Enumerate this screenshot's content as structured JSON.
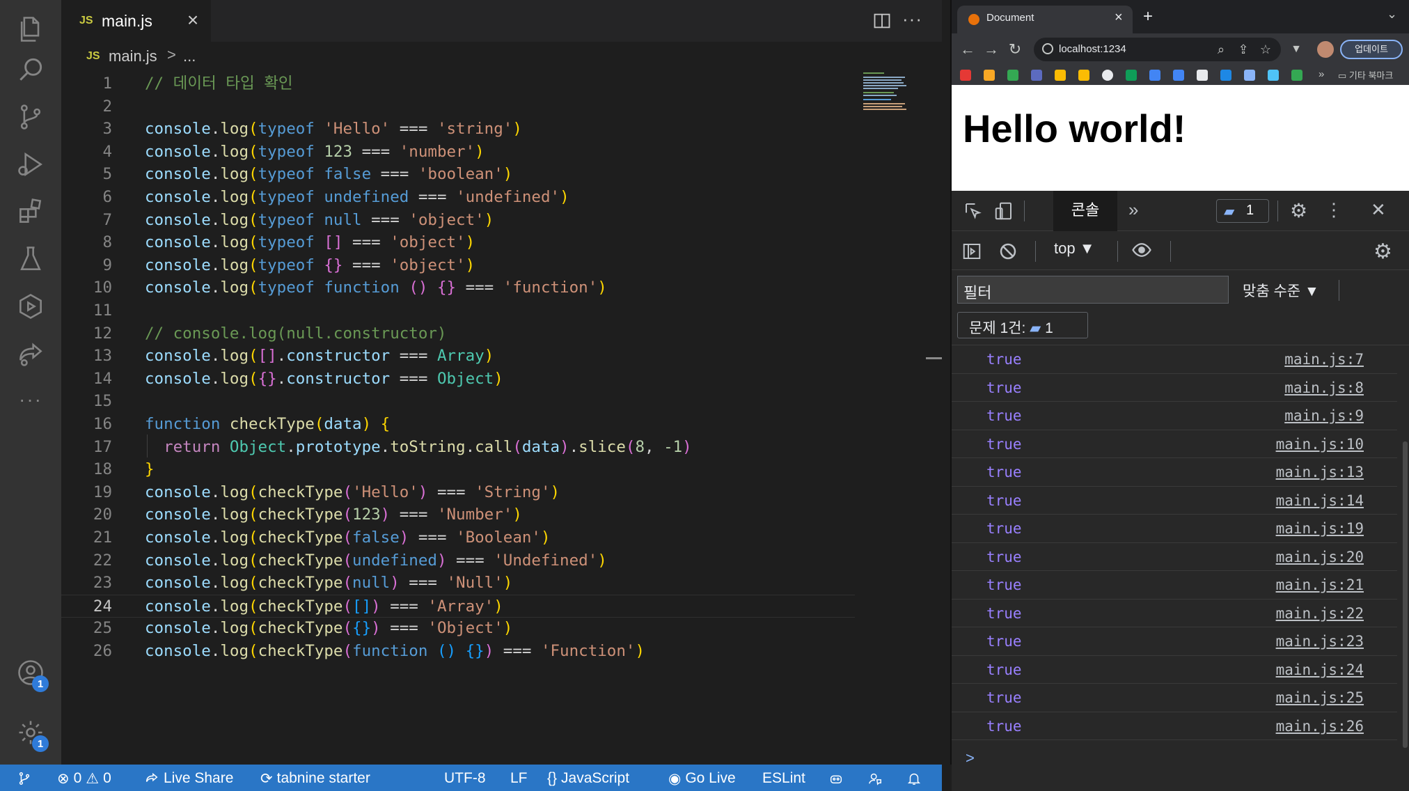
{
  "editor": {
    "tab_label": "main.js",
    "tab_badge": "JS",
    "breadcrumb_file": "main.js",
    "breadcrumb_sep": ">",
    "breadcrumb_rest": "...",
    "current_line": 24,
    "lines": [
      {
        "n": "1",
        "t": [
          [
            "cmt",
            "// 데이터 타입 확인"
          ]
        ]
      },
      {
        "n": "2",
        "t": []
      },
      {
        "n": "3",
        "t": [
          [
            "obj",
            "console"
          ],
          [
            "op",
            "."
          ],
          [
            "fn",
            "log"
          ],
          [
            "b1",
            "("
          ],
          [
            "kw",
            "typeof "
          ],
          [
            "str",
            "'Hello'"
          ],
          [
            "op",
            " === "
          ],
          [
            "str",
            "'string'"
          ],
          [
            "b1",
            ")"
          ]
        ]
      },
      {
        "n": "4",
        "t": [
          [
            "obj",
            "console"
          ],
          [
            "op",
            "."
          ],
          [
            "fn",
            "log"
          ],
          [
            "b1",
            "("
          ],
          [
            "kw",
            "typeof "
          ],
          [
            "num",
            "123"
          ],
          [
            "op",
            " === "
          ],
          [
            "str",
            "'number'"
          ],
          [
            "b1",
            ")"
          ]
        ]
      },
      {
        "n": "5",
        "t": [
          [
            "obj",
            "console"
          ],
          [
            "op",
            "."
          ],
          [
            "fn",
            "log"
          ],
          [
            "b1",
            "("
          ],
          [
            "kw",
            "typeof false"
          ],
          [
            "op",
            " === "
          ],
          [
            "str",
            "'boolean'"
          ],
          [
            "b1",
            ")"
          ]
        ]
      },
      {
        "n": "6",
        "t": [
          [
            "obj",
            "console"
          ],
          [
            "op",
            "."
          ],
          [
            "fn",
            "log"
          ],
          [
            "b1",
            "("
          ],
          [
            "kw",
            "typeof undefined"
          ],
          [
            "op",
            " === "
          ],
          [
            "str",
            "'undefined'"
          ],
          [
            "b1",
            ")"
          ]
        ]
      },
      {
        "n": "7",
        "t": [
          [
            "obj",
            "console"
          ],
          [
            "op",
            "."
          ],
          [
            "fn",
            "log"
          ],
          [
            "b1",
            "("
          ],
          [
            "kw",
            "typeof null"
          ],
          [
            "op",
            " === "
          ],
          [
            "str",
            "'object'"
          ],
          [
            "b1",
            ")"
          ]
        ]
      },
      {
        "n": "8",
        "t": [
          [
            "obj",
            "console"
          ],
          [
            "op",
            "."
          ],
          [
            "fn",
            "log"
          ],
          [
            "b1",
            "("
          ],
          [
            "kw",
            "typeof "
          ],
          [
            "b2",
            "[]"
          ],
          [
            "op",
            " === "
          ],
          [
            "str",
            "'object'"
          ],
          [
            "b1",
            ")"
          ]
        ]
      },
      {
        "n": "9",
        "t": [
          [
            "obj",
            "console"
          ],
          [
            "op",
            "."
          ],
          [
            "fn",
            "log"
          ],
          [
            "b1",
            "("
          ],
          [
            "kw",
            "typeof "
          ],
          [
            "b2",
            "{}"
          ],
          [
            "op",
            " === "
          ],
          [
            "str",
            "'object'"
          ],
          [
            "b1",
            ")"
          ]
        ]
      },
      {
        "n": "10",
        "t": [
          [
            "obj",
            "console"
          ],
          [
            "op",
            "."
          ],
          [
            "fn",
            "log"
          ],
          [
            "b1",
            "("
          ],
          [
            "kw",
            "typeof function "
          ],
          [
            "b2",
            "()"
          ],
          [
            "op",
            " "
          ],
          [
            "b2",
            "{}"
          ],
          [
            "op",
            " === "
          ],
          [
            "str",
            "'function'"
          ],
          [
            "b1",
            ")"
          ]
        ]
      },
      {
        "n": "11",
        "t": []
      },
      {
        "n": "12",
        "t": [
          [
            "cmt",
            "// console.log(null.constructor)"
          ]
        ]
      },
      {
        "n": "13",
        "t": [
          [
            "obj",
            "console"
          ],
          [
            "op",
            "."
          ],
          [
            "fn",
            "log"
          ],
          [
            "b1",
            "("
          ],
          [
            "b2",
            "[]"
          ],
          [
            "op",
            "."
          ],
          [
            "obj",
            "constructor"
          ],
          [
            "op",
            " === "
          ],
          [
            "cls",
            "Array"
          ],
          [
            "b1",
            ")"
          ]
        ]
      },
      {
        "n": "14",
        "t": [
          [
            "obj",
            "console"
          ],
          [
            "op",
            "."
          ],
          [
            "fn",
            "log"
          ],
          [
            "b1",
            "("
          ],
          [
            "b2",
            "{}"
          ],
          [
            "op",
            "."
          ],
          [
            "obj",
            "constructor"
          ],
          [
            "op",
            " === "
          ],
          [
            "cls",
            "Object"
          ],
          [
            "b1",
            ")"
          ]
        ]
      },
      {
        "n": "15",
        "t": []
      },
      {
        "n": "16",
        "t": [
          [
            "kw",
            "function "
          ],
          [
            "fn",
            "checkType"
          ],
          [
            "b1",
            "("
          ],
          [
            "par",
            "data"
          ],
          [
            "b1",
            ")"
          ],
          [
            "op",
            " "
          ],
          [
            "b1",
            "{"
          ]
        ]
      },
      {
        "n": "17",
        "t": [
          [
            "op",
            "  "
          ],
          [
            "ctl",
            "return "
          ],
          [
            "cls",
            "Object"
          ],
          [
            "op",
            "."
          ],
          [
            "obj",
            "prototype"
          ],
          [
            "op",
            "."
          ],
          [
            "fn",
            "toString"
          ],
          [
            "op",
            "."
          ],
          [
            "fn",
            "call"
          ],
          [
            "b2",
            "("
          ],
          [
            "par",
            "data"
          ],
          [
            "b2",
            ")"
          ],
          [
            "op",
            "."
          ],
          [
            "fn",
            "slice"
          ],
          [
            "b2",
            "("
          ],
          [
            "num",
            "8"
          ],
          [
            "op",
            ", "
          ],
          [
            "num",
            "-1"
          ],
          [
            "b2",
            ")"
          ]
        ]
      },
      {
        "n": "18",
        "t": [
          [
            "b1",
            "}"
          ]
        ]
      },
      {
        "n": "19",
        "t": [
          [
            "obj",
            "console"
          ],
          [
            "op",
            "."
          ],
          [
            "fn",
            "log"
          ],
          [
            "b1",
            "("
          ],
          [
            "fn",
            "checkType"
          ],
          [
            "b2",
            "("
          ],
          [
            "str",
            "'Hello'"
          ],
          [
            "b2",
            ")"
          ],
          [
            "op",
            " === "
          ],
          [
            "str",
            "'String'"
          ],
          [
            "b1",
            ")"
          ]
        ]
      },
      {
        "n": "20",
        "t": [
          [
            "obj",
            "console"
          ],
          [
            "op",
            "."
          ],
          [
            "fn",
            "log"
          ],
          [
            "b1",
            "("
          ],
          [
            "fn",
            "checkType"
          ],
          [
            "b2",
            "("
          ],
          [
            "num",
            "123"
          ],
          [
            "b2",
            ")"
          ],
          [
            "op",
            " === "
          ],
          [
            "str",
            "'Number'"
          ],
          [
            "b1",
            ")"
          ]
        ]
      },
      {
        "n": "21",
        "t": [
          [
            "obj",
            "console"
          ],
          [
            "op",
            "."
          ],
          [
            "fn",
            "log"
          ],
          [
            "b1",
            "("
          ],
          [
            "fn",
            "checkType"
          ],
          [
            "b2",
            "("
          ],
          [
            "kw",
            "false"
          ],
          [
            "b2",
            ")"
          ],
          [
            "op",
            " === "
          ],
          [
            "str",
            "'Boolean'"
          ],
          [
            "b1",
            ")"
          ]
        ]
      },
      {
        "n": "22",
        "t": [
          [
            "obj",
            "console"
          ],
          [
            "op",
            "."
          ],
          [
            "fn",
            "log"
          ],
          [
            "b1",
            "("
          ],
          [
            "fn",
            "checkType"
          ],
          [
            "b2",
            "("
          ],
          [
            "kw",
            "undefined"
          ],
          [
            "b2",
            ")"
          ],
          [
            "op",
            " === "
          ],
          [
            "str",
            "'Undefined'"
          ],
          [
            "b1",
            ")"
          ]
        ]
      },
      {
        "n": "23",
        "t": [
          [
            "obj",
            "console"
          ],
          [
            "op",
            "."
          ],
          [
            "fn",
            "log"
          ],
          [
            "b1",
            "("
          ],
          [
            "fn",
            "checkType"
          ],
          [
            "b2",
            "("
          ],
          [
            "kw",
            "null"
          ],
          [
            "b2",
            ")"
          ],
          [
            "op",
            " === "
          ],
          [
            "str",
            "'Null'"
          ],
          [
            "b1",
            ")"
          ]
        ]
      },
      {
        "n": "24",
        "t": [
          [
            "obj",
            "console"
          ],
          [
            "op",
            "."
          ],
          [
            "fn",
            "log"
          ],
          [
            "b1",
            "("
          ],
          [
            "fn",
            "checkType"
          ],
          [
            "b2",
            "("
          ],
          [
            "b3",
            "[]"
          ],
          [
            "b2",
            ")"
          ],
          [
            "op",
            " === "
          ],
          [
            "str",
            "'Array'"
          ],
          [
            "b1",
            ")"
          ]
        ]
      },
      {
        "n": "25",
        "t": [
          [
            "obj",
            "console"
          ],
          [
            "op",
            "."
          ],
          [
            "fn",
            "log"
          ],
          [
            "b1",
            "("
          ],
          [
            "fn",
            "checkType"
          ],
          [
            "b2",
            "("
          ],
          [
            "b3",
            "{}"
          ],
          [
            "b2",
            ")"
          ],
          [
            "op",
            " === "
          ],
          [
            "str",
            "'Object'"
          ],
          [
            "b1",
            ")"
          ]
        ]
      },
      {
        "n": "26",
        "t": [
          [
            "obj",
            "console"
          ],
          [
            "op",
            "."
          ],
          [
            "fn",
            "log"
          ],
          [
            "b1",
            "("
          ],
          [
            "fn",
            "checkType"
          ],
          [
            "b2",
            "("
          ],
          [
            "kw",
            "function "
          ],
          [
            "b3",
            "()"
          ],
          [
            "op",
            " "
          ],
          [
            "b3",
            "{}"
          ],
          [
            "b2",
            ")"
          ],
          [
            "op",
            " === "
          ],
          [
            "str",
            "'Function'"
          ],
          [
            "b1",
            ")"
          ]
        ]
      }
    ]
  },
  "activity_bar": {
    "icons": [
      "files-icon",
      "search-icon",
      "source-control-icon",
      "run-debug-icon",
      "extensions-icon",
      "testing-icon",
      "remote-icon",
      "live-share-icon",
      "more-icon"
    ],
    "account_badge": "1",
    "settings_badge": "1"
  },
  "statusbar": {
    "errors": "0",
    "warnings": "0",
    "live_share": "Live Share",
    "tabnine": "tabnine starter",
    "encoding": "UTF-8",
    "eol": "LF",
    "language": "JavaScript",
    "language_prefix": "{}",
    "go_live": "Go Live",
    "eslint": "ESLint"
  },
  "browser": {
    "tab_title": "Document",
    "url": "localhost:1234",
    "update_label": "업데이트",
    "bookmarks_folder": "기타 북마크",
    "page_heading": "Hello world!",
    "devtools": {
      "console_tab": "콘솔",
      "issues_count": "1",
      "context": "top",
      "filter_placeholder": "필터",
      "levels_label": "맞춤 수준",
      "issues_label": "문제 1건:",
      "issues_chip_count": "1",
      "prompt": ">",
      "logs": [
        {
          "value": "true",
          "source": "main.js:7"
        },
        {
          "value": "true",
          "source": "main.js:8"
        },
        {
          "value": "true",
          "source": "main.js:9"
        },
        {
          "value": "true",
          "source": "main.js:10"
        },
        {
          "value": "true",
          "source": "main.js:13"
        },
        {
          "value": "true",
          "source": "main.js:14"
        },
        {
          "value": "true",
          "source": "main.js:19"
        },
        {
          "value": "true",
          "source": "main.js:20"
        },
        {
          "value": "true",
          "source": "main.js:21"
        },
        {
          "value": "true",
          "source": "main.js:22"
        },
        {
          "value": "true",
          "source": "main.js:23"
        },
        {
          "value": "true",
          "source": "main.js:24"
        },
        {
          "value": "true",
          "source": "main.js:25"
        },
        {
          "value": "true",
          "source": "main.js:26"
        }
      ]
    }
  },
  "colors": {
    "statusbar": "#2a76c6",
    "console_true": "#9980ff",
    "activity_bar": "#333333",
    "editor_bg": "#1e1e1e"
  }
}
